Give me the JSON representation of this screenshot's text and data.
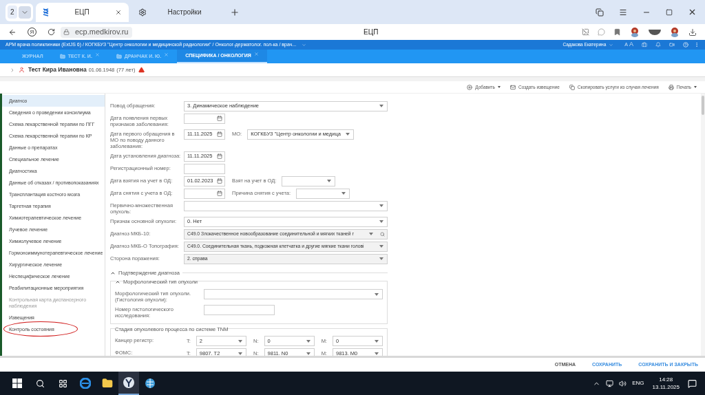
{
  "browser": {
    "tab_count": "2",
    "tabs": [
      {
        "title": "ЕЦП",
        "selected": true,
        "kind": "site"
      },
      {
        "title": "Настройки",
        "selected": false,
        "kind": "settings"
      }
    ],
    "yandex_button": "Я",
    "url": "ecp.medkirov.ru",
    "page_title": "ЕЦП"
  },
  "app": {
    "breadcrumb": "АРМ врача поликлиники (ExtJS 6) / КОГКБУЗ \"Центр онкологии и медицинской радиологии\" / Онколог-дерматолог. пол-ка / врач...",
    "user": "Садакова Екатерина",
    "font_buttons": [
      "A",
      "A"
    ],
    "tabs": [
      {
        "label": "ЖУРНАЛ",
        "selected": false,
        "icon": false,
        "closable": false
      },
      {
        "label": "ТЕСТ К. И.",
        "selected": false,
        "icon": true,
        "closable": true
      },
      {
        "label": "ДРАНЧАК И. Ю.",
        "selected": false,
        "icon": true,
        "closable": true
      },
      {
        "label": "СПЕЦИФИКА / ОНКОЛОГИЯ",
        "selected": true,
        "icon": false,
        "closable": true
      }
    ]
  },
  "patient": {
    "name": "Тест Кира Ивановна",
    "birth_date": "01.06.1948",
    "age": "(77 лет)",
    "warning": true
  },
  "toolbar": [
    {
      "label": "Добавить",
      "dropdown": true
    },
    {
      "label": "Создать извещение",
      "dropdown": false
    },
    {
      "label": "Скопировать услуги из случая лечения",
      "dropdown": false
    },
    {
      "label": "Печать",
      "dropdown": true
    }
  ],
  "sidebar": [
    {
      "label": "Диагноз",
      "selected": true,
      "disabled": false,
      "circled": false
    },
    {
      "label": "Сведения о проведении консилиума",
      "selected": false,
      "disabled": false,
      "circled": false
    },
    {
      "label": "Схема лекарственной терапии по ПГГ",
      "selected": false,
      "disabled": false,
      "circled": false
    },
    {
      "label": "Схема лекарственной терапии по КР",
      "selected": false,
      "disabled": false,
      "circled": false
    },
    {
      "label": "Данные о препаратах",
      "selected": false,
      "disabled": false,
      "circled": false
    },
    {
      "label": "Специальное лечение",
      "selected": false,
      "disabled": false,
      "circled": false
    },
    {
      "label": "Диагностика",
      "selected": false,
      "disabled": false,
      "circled": false
    },
    {
      "label": "Данные об отказах / противопоказаниях",
      "selected": false,
      "disabled": false,
      "circled": false
    },
    {
      "label": "Трансплантация костного мозга",
      "selected": false,
      "disabled": false,
      "circled": false
    },
    {
      "label": "Таргетная терапия",
      "selected": false,
      "disabled": false,
      "circled": false
    },
    {
      "label": "Химиотерапевтическое лечение",
      "selected": false,
      "disabled": false,
      "circled": false
    },
    {
      "label": "Лучевое лечение",
      "selected": false,
      "disabled": false,
      "circled": false
    },
    {
      "label": "Химиолучевое лечение",
      "selected": false,
      "disabled": false,
      "circled": false
    },
    {
      "label": "Гормоноиммунотерапевтическое лечение",
      "selected": false,
      "disabled": false,
      "circled": false
    },
    {
      "label": "Хирургическое лечение",
      "selected": false,
      "disabled": false,
      "circled": false
    },
    {
      "label": "Неспецифическое лечение",
      "selected": false,
      "disabled": false,
      "circled": false
    },
    {
      "label": "Реабилитационные мероприятия",
      "selected": false,
      "disabled": false,
      "circled": false
    },
    {
      "label": "Контрольная карта диспансерного наблюдения",
      "selected": false,
      "disabled": true,
      "circled": false
    },
    {
      "label": "Извещения",
      "selected": false,
      "disabled": false,
      "circled": false
    },
    {
      "label": "Контроль состояния",
      "selected": false,
      "disabled": false,
      "circled": true
    }
  ],
  "form": {
    "sections": [
      {
        "kind": "rows",
        "rows": [
          {
            "label": "Повод обращения:",
            "fields": [
              {
                "kind": "select",
                "value": "3. Динамическое наблюдение"
              }
            ]
          },
          {
            "label": "Дата появления первых признаков заболевания:",
            "fields": [
              {
                "kind": "date"
              }
            ]
          },
          {
            "label": "Дата первого обращения в МО по поводу данного заболевания:",
            "fields": [
              {
                "kind": "date",
                "value": "11.11.2025"
              },
              {
                "kind": "org_select",
                "label": "МО:",
                "value": "КОГКБУЗ \"Центр онкологии и медица"
              }
            ]
          },
          {
            "label": "Дата установления диагноза:",
            "fields": [
              {
                "kind": "date",
                "value": "11.11.2025"
              }
            ]
          },
          {
            "label": "Регистрационный номер:",
            "fields": [
              {
                "kind": "text"
              }
            ]
          },
          {
            "label": "Дата взятия на учет в ОД:",
            "fields": [
              {
                "kind": "date",
                "value": "01.02.2023"
              },
              {
                "kind": "short_select",
                "label": "Взят на учет в ОД:"
              }
            ]
          },
          {
            "label": "Дата снятия с учета в ОД:",
            "fields": [
              {
                "kind": "date"
              },
              {
                "kind": "short_select",
                "label": "Причина снятия с учета:"
              }
            ]
          },
          {
            "label": "Первично-множественная опухоль:",
            "fields": [
              {
                "kind": "select"
              }
            ]
          },
          {
            "label": "Признак основной опухоли:",
            "fields": [
              {
                "kind": "select",
                "value": "0. Нет"
              }
            ]
          },
          {
            "label": "Диагноз МКБ-10:",
            "fields": [
              {
                "kind": "lookup",
                "readonly": true,
                "value": "C49.0 Злокачественное новообразование соединительной и мягких тканей г"
              }
            ]
          },
          {
            "label": "Диагноз МКБ-О Топография:",
            "fields": [
              {
                "kind": "select",
                "readonly": true,
                "value": "C49.0. Соединительная ткань, подкожная клетчатка и другие мягкие ткани голові"
              }
            ]
          },
          {
            "label": "Сторона поражения:",
            "fields": [
              {
                "kind": "select",
                "readonly": true,
                "value": "2. справа"
              }
            ]
          }
        ]
      },
      {
        "kind": "divider",
        "title": "Подтверждение диагноза",
        "expanded": true
      },
      {
        "kind": "fieldset",
        "title": "Морфологический тип опухоли",
        "expanded": true,
        "rows": [
          {
            "label": "Морфологический тип опухоли. (Гистология опухоли):",
            "fields": [
              {
                "kind": "select"
              }
            ]
          },
          {
            "label": "Номер гистологического исследования:",
            "fields": [
              {
                "kind": "wide_text"
              }
            ]
          }
        ]
      },
      {
        "kind": "fieldset",
        "title": "Стадия опухолевого процесса по системе TNM",
        "rows": [
          {
            "label": "Канцер регистр:",
            "fields": [
              {
                "kind": "tnm_select",
                "label": "T:",
                "value": "2"
              },
              {
                "kind": "tnm_select",
                "label": "N:",
                "value": "0"
              },
              {
                "kind": "tnm_select",
                "label": "M:",
                "value": "0"
              }
            ]
          },
          {
            "label": "ФОМС:",
            "fields": [
              {
                "kind": "tnm_select",
                "label": "T:",
                "value": "9807. T2"
              },
              {
                "kind": "tnm_select",
                "label": "N:",
                "value": "9811. N0"
              },
              {
                "kind": "tnm_select",
                "label": "M:",
                "value": "9813. M0"
              }
            ]
          }
        ]
      }
    ]
  },
  "footer_buttons": [
    {
      "label": "ОТМЕНА",
      "kind": "plain"
    },
    {
      "label": "СОХРАНИТЬ",
      "kind": "primary"
    },
    {
      "label": "СОХРАНИТЬ И ЗАКРЫТЬ",
      "kind": "primary"
    }
  ],
  "taskbar": {
    "language": "ENG",
    "time": "14:28",
    "date": "13.11.2025"
  }
}
